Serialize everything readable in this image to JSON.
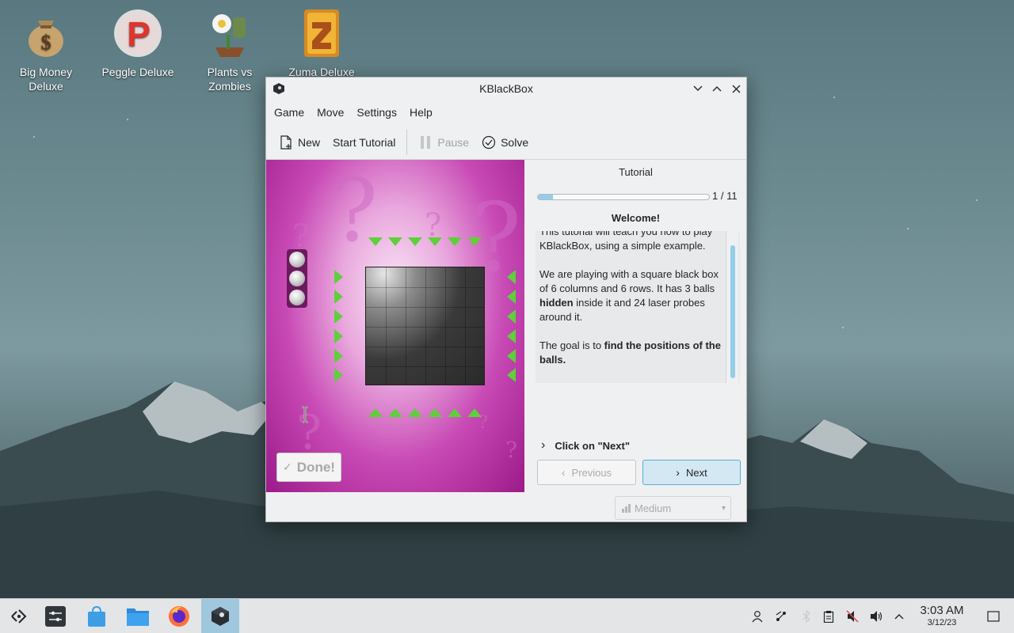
{
  "desktop": {
    "icons": [
      {
        "label": "Big Money Deluxe",
        "icon": "money-bag-icon"
      },
      {
        "label": "Peggle Deluxe",
        "icon": "peggle-icon"
      },
      {
        "label": "Plants vs Zombies",
        "icon": "plants-vs-zombies-icon"
      },
      {
        "label": "Zuma Deluxe",
        "icon": "zuma-icon"
      }
    ]
  },
  "window": {
    "title": "KBlackBox",
    "menu": [
      "Game",
      "Move",
      "Settings",
      "Help"
    ],
    "toolbar": {
      "new_label": "New",
      "tutorial_label": "Start Tutorial",
      "pause_label": "Pause",
      "solve_label": "Solve"
    },
    "board": {
      "done_label": "Done!",
      "balls_remaining": 3,
      "columns": 6,
      "rows": 6
    },
    "tutorial": {
      "title": "Tutorial",
      "progress_text": "1 / 11",
      "progress_fraction": 0.09,
      "heading": "Welcome!",
      "para1": "This tutorial will teach you how to play KBlackBox, using a simple example.",
      "para2_a": "We are playing with a square black box of 6 columns and 6 rows. It has 3 balls ",
      "para2_bold": "hidden",
      "para2_b": " inside it and 24 laser probes around it.",
      "para3_a": "The goal is to ",
      "para3_bold": "find the positions of the balls.",
      "hint": "Click on \"Next\"",
      "previous_label": "Previous",
      "next_label": "Next"
    },
    "difficulty": "Medium"
  },
  "taskbar": {
    "time": "3:03 AM",
    "date": "3/12/23"
  },
  "colors": {
    "accent": "#93cee9",
    "laser": "#5fcf3b",
    "board": "#c84ab5"
  }
}
